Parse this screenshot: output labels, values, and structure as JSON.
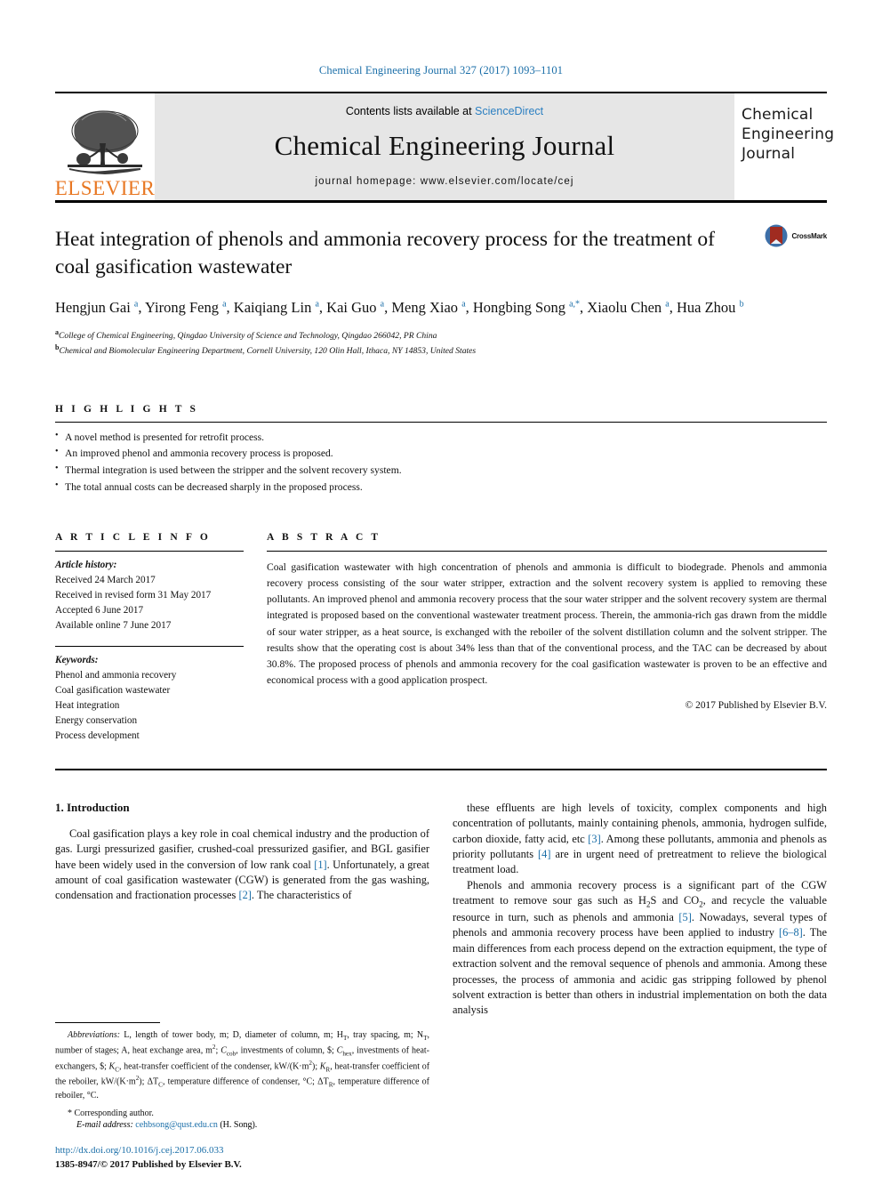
{
  "running_head": "Chemical Engineering Journal 327 (2017) 1093–1101",
  "masthead": {
    "publisher_name": "ELSEVIER",
    "contents_prefix": "Contents lists available at ",
    "contents_link": "ScienceDirect",
    "journal_name": "Chemical Engineering Journal",
    "homepage": "journal homepage: www.elsevier.com/locate/cej",
    "cover_lines": [
      "Chemical",
      "Engineering",
      "Journal"
    ]
  },
  "article": {
    "title": "Heat integration of phenols and ammonia recovery process for the treatment of coal gasification wastewater",
    "crossmark_label": "CrossMark",
    "authors_html": "Hengjun Gai <sup>a</sup>, Yirong Feng <sup>a</sup>, Kaiqiang Lin <sup>a</sup>, Kai Guo <sup>a</sup>, Meng Xiao <sup>a</sup>, Hongbing Song <sup>a,*</sup>, Xiaolu Chen <sup>a</sup>, Hua Zhou <sup>b</sup>",
    "affiliation_a": "College of Chemical Engineering, Qingdao University of Science and Technology, Qingdao 266042, PR China",
    "affiliation_b": "Chemical and Biomolecular Engineering Department, Cornell University, 120 Olin Hall, Ithaca, NY 14853, United States"
  },
  "highlights": {
    "heading": "H I G H L I G H T S",
    "items": [
      "A novel method is presented for retrofit process.",
      "An improved phenol and ammonia recovery process is proposed.",
      "Thermal integration is used between the stripper and the solvent recovery system.",
      "The total annual costs can be decreased sharply in the proposed process."
    ]
  },
  "article_info": {
    "heading": "A R T I C L E   I N F O",
    "history_label": "Article history:",
    "history": [
      "Received 24 March 2017",
      "Received in revised form 31 May 2017",
      "Accepted 6 June 2017",
      "Available online 7 June 2017"
    ],
    "keywords_label": "Keywords:",
    "keywords": [
      "Phenol and ammonia recovery",
      "Coal gasification wastewater",
      "Heat integration",
      "Energy conservation",
      "Process development"
    ]
  },
  "abstract": {
    "heading": "A B S T R A C T",
    "text": "Coal gasification wastewater with high concentration of phenols and ammonia is difficult to biodegrade. Phenols and ammonia recovery process consisting of the sour water stripper, extraction and the solvent recovery system is applied to removing these pollutants. An improved phenol and ammonia recovery process that the sour water stripper and the solvent recovery system are thermal integrated is proposed based on the conventional wastewater treatment process. Therein, the ammonia-rich gas drawn from the middle of sour water stripper, as a heat source, is exchanged with the reboiler of the solvent distillation column and the solvent stripper. The results show that the operating cost is about 34% less than that of the conventional process, and the TAC can be decreased by about 30.8%. The proposed process of phenols and ammonia recovery for the coal gasification wastewater is proven to be an effective and economical process with a good application prospect.",
    "copyright": "© 2017 Published by Elsevier B.V."
  },
  "body": {
    "section_title": "1. Introduction",
    "left_paragraphs": [
      "Coal gasification plays a key role in coal chemical industry and the production of gas. Lurgi pressurized gasifier, crushed-coal pressurized gasifier, and BGL gasifier have been widely used in the conversion of low rank coal [1]. Unfortunately, a great amount of coal gasification wastewater (CGW) is generated from the gas washing, condensation and fractionation processes [2]. The characteristics of"
    ],
    "right_paragraphs": [
      "these effluents are high levels of toxicity, complex components and high concentration of pollutants, mainly containing phenols, ammonia, hydrogen sulfide, carbon dioxide, fatty acid, etc [3]. Among these pollutants, ammonia and phenols as priority pollutants [4] are in urgent need of pretreatment to relieve the biological treatment load.",
      "Phenols and ammonia recovery process is a significant part of the CGW treatment to remove sour gas such as H2S and CO2, and recycle the valuable resource in turn, such as phenols and ammonia [5]. Nowadays, several types of phenols and ammonia recovery process have been applied to industry [6–8]. The main differences from each process depend on the extraction equipment, the type of extraction solvent and the removal sequence of phenols and ammonia. Among these processes, the process of ammonia and acidic gas stripping followed by phenol solvent extraction is better than others in industrial implementation on both the data analysis"
    ]
  },
  "footnotes": {
    "abbreviations_label": "Abbreviations:",
    "abbreviations_text": "L, length of tower body, m; D, diameter of column, m; HT, tray spacing, m; NT, number of stages; A, heat exchange area, m2; Ccob, investments of column, $; Chex, investments of heat-exchangers, $; KC, heat-transfer coefficient of the condenser, kW/(K·m2); KR, heat-transfer coefficient of the reboiler, kW/(K·m2); ΔTC, temperature difference of condenser, °C; ΔTR, temperature difference of reboiler, °C.",
    "corresponding": "* Corresponding author.",
    "email_label": "E-mail address:",
    "email": "cehbsong@qust.edu.cn",
    "email_suffix": "(H. Song).",
    "doi": "http://dx.doi.org/10.1016/j.cej.2017.06.033",
    "issn_line": "1385-8947/© 2017 Published by Elsevier B.V."
  },
  "colors": {
    "link_blue": "#1a6ea8",
    "sciencedirect_blue": "#2b7fc1",
    "elsevier_orange": "#E87722",
    "band_gray": "#e6e6e6"
  }
}
